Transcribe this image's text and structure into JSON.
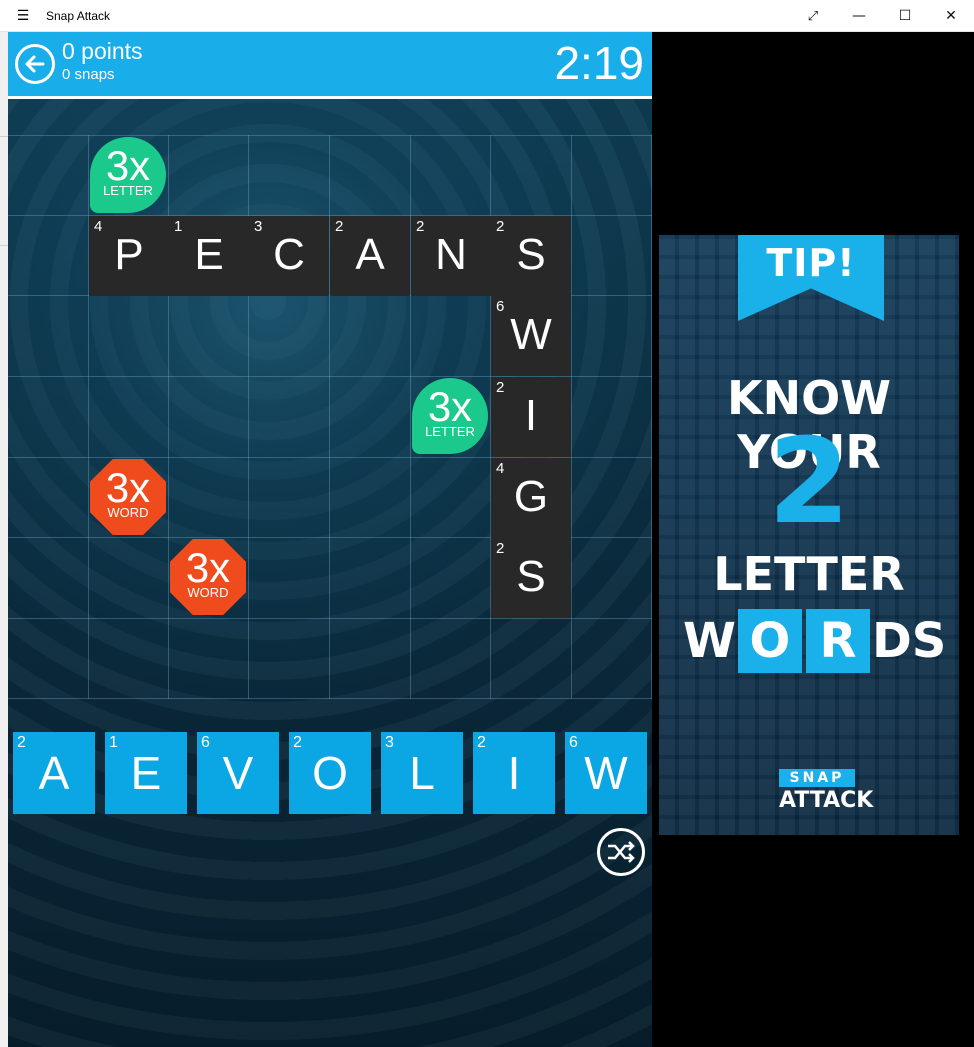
{
  "window": {
    "title": "Snap Attack",
    "menu_icon": "hamburger-menu-icon",
    "controls": [
      "expand-icon",
      "minimize-icon",
      "maximize-icon",
      "close-icon"
    ]
  },
  "header": {
    "points": "0 points",
    "snaps": "0 snaps",
    "timer": "2:19",
    "accent_color": "#19aeea"
  },
  "board": {
    "placed_tiles": [
      {
        "letter": "P",
        "value": "4"
      },
      {
        "letter": "E",
        "value": "1"
      },
      {
        "letter": "C",
        "value": "3"
      },
      {
        "letter": "A",
        "value": "2"
      },
      {
        "letter": "N",
        "value": "2"
      },
      {
        "letter": "S",
        "value": "2"
      },
      {
        "letter": "W",
        "value": "6"
      },
      {
        "letter": "I",
        "value": "2"
      },
      {
        "letter": "G",
        "value": "4"
      },
      {
        "letter": "S",
        "value": "2"
      }
    ],
    "bonuses": [
      {
        "multiplier": "3x",
        "type": "LETTER",
        "color": "#1cc98d"
      },
      {
        "multiplier": "3x",
        "type": "LETTER",
        "color": "#1cc98d"
      },
      {
        "multiplier": "3x",
        "type": "WORD",
        "color": "#f04b1c"
      },
      {
        "multiplier": "3x",
        "type": "WORD",
        "color": "#f04b1c"
      }
    ]
  },
  "rack": {
    "tiles": [
      {
        "letter": "A",
        "value": "2"
      },
      {
        "letter": "E",
        "value": "1"
      },
      {
        "letter": "V",
        "value": "6"
      },
      {
        "letter": "O",
        "value": "2"
      },
      {
        "letter": "L",
        "value": "3"
      },
      {
        "letter": "I",
        "value": "2"
      },
      {
        "letter": "W",
        "value": "6"
      }
    ],
    "shuffle_icon": "shuffle-icon"
  },
  "tip": {
    "banner": "TIP!",
    "line1": "KNOW YOUR",
    "number": "2",
    "line3": "LETTER",
    "line4_parts": [
      "W",
      "O",
      "R",
      "DS"
    ],
    "logo_top": "SNAP",
    "logo_bottom": "ATTACK"
  }
}
